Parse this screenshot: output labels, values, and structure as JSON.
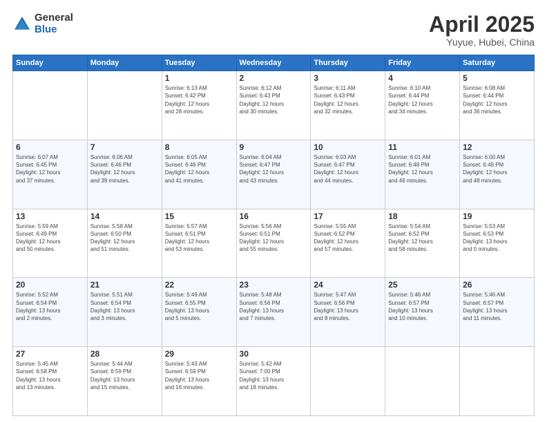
{
  "header": {
    "logo_general": "General",
    "logo_blue": "Blue",
    "month": "April 2025",
    "location": "Yuyue, Hubei, China"
  },
  "days_of_week": [
    "Sunday",
    "Monday",
    "Tuesday",
    "Wednesday",
    "Thursday",
    "Friday",
    "Saturday"
  ],
  "weeks": [
    [
      {
        "day": "",
        "info": ""
      },
      {
        "day": "",
        "info": ""
      },
      {
        "day": "1",
        "info": "Sunrise: 6:13 AM\nSunset: 6:42 PM\nDaylight: 12 hours\nand 28 minutes."
      },
      {
        "day": "2",
        "info": "Sunrise: 6:12 AM\nSunset: 6:43 PM\nDaylight: 12 hours\nand 30 minutes."
      },
      {
        "day": "3",
        "info": "Sunrise: 6:11 AM\nSunset: 6:43 PM\nDaylight: 12 hours\nand 32 minutes."
      },
      {
        "day": "4",
        "info": "Sunrise: 6:10 AM\nSunset: 6:44 PM\nDaylight: 12 hours\nand 34 minutes."
      },
      {
        "day": "5",
        "info": "Sunrise: 6:08 AM\nSunset: 6:44 PM\nDaylight: 12 hours\nand 36 minutes."
      }
    ],
    [
      {
        "day": "6",
        "info": "Sunrise: 6:07 AM\nSunset: 6:45 PM\nDaylight: 12 hours\nand 37 minutes."
      },
      {
        "day": "7",
        "info": "Sunrise: 6:06 AM\nSunset: 6:46 PM\nDaylight: 12 hours\nand 39 minutes."
      },
      {
        "day": "8",
        "info": "Sunrise: 6:05 AM\nSunset: 6:46 PM\nDaylight: 12 hours\nand 41 minutes."
      },
      {
        "day": "9",
        "info": "Sunrise: 6:04 AM\nSunset: 6:47 PM\nDaylight: 12 hours\nand 43 minutes."
      },
      {
        "day": "10",
        "info": "Sunrise: 6:03 AM\nSunset: 6:47 PM\nDaylight: 12 hours\nand 44 minutes."
      },
      {
        "day": "11",
        "info": "Sunrise: 6:01 AM\nSunset: 6:48 PM\nDaylight: 12 hours\nand 46 minutes."
      },
      {
        "day": "12",
        "info": "Sunrise: 6:00 AM\nSunset: 6:49 PM\nDaylight: 12 hours\nand 48 minutes."
      }
    ],
    [
      {
        "day": "13",
        "info": "Sunrise: 5:59 AM\nSunset: 6:49 PM\nDaylight: 12 hours\nand 50 minutes."
      },
      {
        "day": "14",
        "info": "Sunrise: 5:58 AM\nSunset: 6:50 PM\nDaylight: 12 hours\nand 51 minutes."
      },
      {
        "day": "15",
        "info": "Sunrise: 5:57 AM\nSunset: 6:51 PM\nDaylight: 12 hours\nand 53 minutes."
      },
      {
        "day": "16",
        "info": "Sunrise: 5:56 AM\nSunset: 6:51 PM\nDaylight: 12 hours\nand 55 minutes."
      },
      {
        "day": "17",
        "info": "Sunrise: 5:55 AM\nSunset: 6:52 PM\nDaylight: 12 hours\nand 57 minutes."
      },
      {
        "day": "18",
        "info": "Sunrise: 5:54 AM\nSunset: 6:52 PM\nDaylight: 12 hours\nand 58 minutes."
      },
      {
        "day": "19",
        "info": "Sunrise: 5:53 AM\nSunset: 6:53 PM\nDaylight: 13 hours\nand 0 minutes."
      }
    ],
    [
      {
        "day": "20",
        "info": "Sunrise: 5:52 AM\nSunset: 6:54 PM\nDaylight: 13 hours\nand 2 minutes."
      },
      {
        "day": "21",
        "info": "Sunrise: 5:51 AM\nSunset: 6:54 PM\nDaylight: 13 hours\nand 3 minutes."
      },
      {
        "day": "22",
        "info": "Sunrise: 5:49 AM\nSunset: 6:55 PM\nDaylight: 13 hours\nand 5 minutes."
      },
      {
        "day": "23",
        "info": "Sunrise: 5:48 AM\nSunset: 6:56 PM\nDaylight: 13 hours\nand 7 minutes."
      },
      {
        "day": "24",
        "info": "Sunrise: 5:47 AM\nSunset: 6:56 PM\nDaylight: 13 hours\nand 8 minutes."
      },
      {
        "day": "25",
        "info": "Sunrise: 5:46 AM\nSunset: 6:57 PM\nDaylight: 13 hours\nand 10 minutes."
      },
      {
        "day": "26",
        "info": "Sunrise: 5:46 AM\nSunset: 6:57 PM\nDaylight: 13 hours\nand 11 minutes."
      }
    ],
    [
      {
        "day": "27",
        "info": "Sunrise: 5:45 AM\nSunset: 6:58 PM\nDaylight: 13 hours\nand 13 minutes."
      },
      {
        "day": "28",
        "info": "Sunrise: 5:44 AM\nSunset: 6:59 PM\nDaylight: 13 hours\nand 15 minutes."
      },
      {
        "day": "29",
        "info": "Sunrise: 5:43 AM\nSunset: 6:59 PM\nDaylight: 13 hours\nand 16 minutes."
      },
      {
        "day": "30",
        "info": "Sunrise: 5:42 AM\nSunset: 7:00 PM\nDaylight: 13 hours\nand 18 minutes."
      },
      {
        "day": "",
        "info": ""
      },
      {
        "day": "",
        "info": ""
      },
      {
        "day": "",
        "info": ""
      }
    ]
  ]
}
